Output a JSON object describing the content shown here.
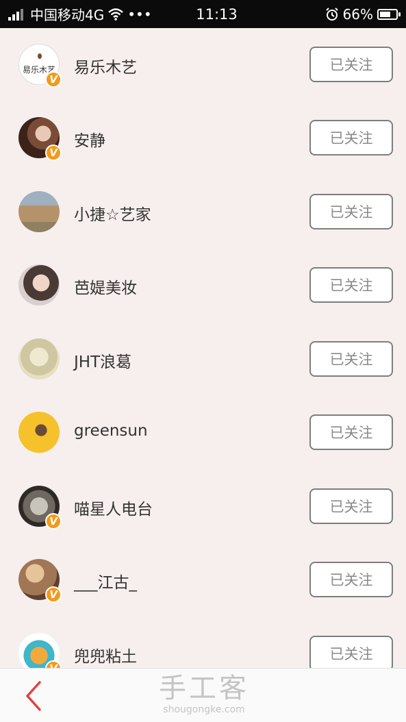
{
  "status_bar": {
    "carrier": "中国移动4G",
    "dots": "•••",
    "time": "11:13",
    "battery": "66%",
    "battery_level": 0.66
  },
  "follow_list": [
    {
      "name": "易乐木艺",
      "button": "已关注",
      "verified": true,
      "avatar_logo": "易乐木艺"
    },
    {
      "name": "安静",
      "button": "已关注",
      "verified": true
    },
    {
      "name": "小捷☆艺家",
      "button": "已关注",
      "verified": false
    },
    {
      "name": "芭媞美妆",
      "button": "已关注",
      "verified": false
    },
    {
      "name": "JHT浪葛",
      "button": "已关注",
      "verified": false
    },
    {
      "name": "greensun",
      "button": "已关注",
      "verified": false
    },
    {
      "name": "喵星人电台",
      "button": "已关注",
      "verified": true
    },
    {
      "name": "___江古_",
      "button": "已关注",
      "verified": true
    },
    {
      "name": "兜兜粘土",
      "button": "已关注",
      "verified": true
    }
  ],
  "badge_glyph": "V",
  "bottom_bar": {
    "brand_zh": "手工客",
    "brand_en": "shougongke.com"
  },
  "colors": {
    "background": "#f7efee",
    "badge": "#f39a1a",
    "back_arrow": "#e0433f",
    "button_border": "#7d7d7d"
  }
}
